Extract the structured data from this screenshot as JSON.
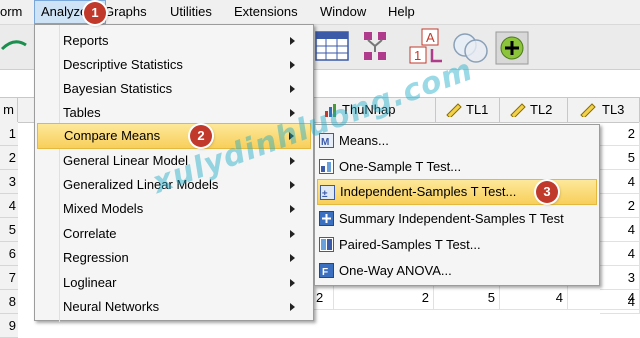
{
  "menubar": {
    "items": [
      {
        "label": "orm"
      },
      {
        "label": "Analyze"
      },
      {
        "label": "Graphs"
      },
      {
        "label": "Utilities"
      },
      {
        "label": "Extensions"
      },
      {
        "label": "Window"
      },
      {
        "label": "Help"
      }
    ]
  },
  "grid": {
    "first_col_header": "m",
    "columns": [
      {
        "label": "ThuNhap"
      },
      {
        "label": "TL1"
      },
      {
        "label": "TL2"
      },
      {
        "label": "TL3"
      }
    ],
    "row_numbers": [
      "1",
      "2",
      "3",
      "4",
      "5",
      "6",
      "7",
      "8",
      "9"
    ],
    "right_col_values": [
      "2",
      "5",
      "4",
      "2",
      "4",
      "4",
      "3",
      "4",
      ""
    ],
    "bottom_row": {
      "c1": "2",
      "c2": "2",
      "c3": "5",
      "c4": "4",
      "c5": "4"
    }
  },
  "analyze_menu": {
    "items": [
      {
        "label": "Reports",
        "arrow": true
      },
      {
        "label": "Descriptive Statistics",
        "arrow": true
      },
      {
        "label": "Bayesian Statistics",
        "arrow": true
      },
      {
        "label": "Tables",
        "arrow": true
      },
      {
        "label": "Compare Means",
        "arrow": true
      },
      {
        "label": "General Linear Model",
        "arrow": true
      },
      {
        "label": "Generalized Linear Models",
        "arrow": true
      },
      {
        "label": "Mixed Models",
        "arrow": true
      },
      {
        "label": "Correlate",
        "arrow": true
      },
      {
        "label": "Regression",
        "arrow": true
      },
      {
        "label": "Loglinear",
        "arrow": true
      },
      {
        "label": "Neural Networks",
        "arrow": true
      }
    ]
  },
  "compare_means_menu": {
    "items": [
      {
        "label": "Means...",
        "icon": "means-icon"
      },
      {
        "label": "One-Sample T Test...",
        "icon": "one-sample-icon"
      },
      {
        "label": "Independent-Samples T Test...",
        "icon": "independent-samples-icon"
      },
      {
        "label": "Summary Independent-Samples T Test",
        "icon": "summary-test-icon"
      },
      {
        "label": "Paired-Samples T Test...",
        "icon": "paired-samples-icon"
      },
      {
        "label": "One-Way ANOVA...",
        "icon": "anova-icon"
      }
    ]
  },
  "steps": {
    "one": "1",
    "two": "2",
    "three": "3"
  },
  "watermark": "xulydinhluong.com",
  "colors": {
    "highlight": "#f8cf5a",
    "badge": "#c0392b",
    "watermark": "#1eaac8"
  }
}
